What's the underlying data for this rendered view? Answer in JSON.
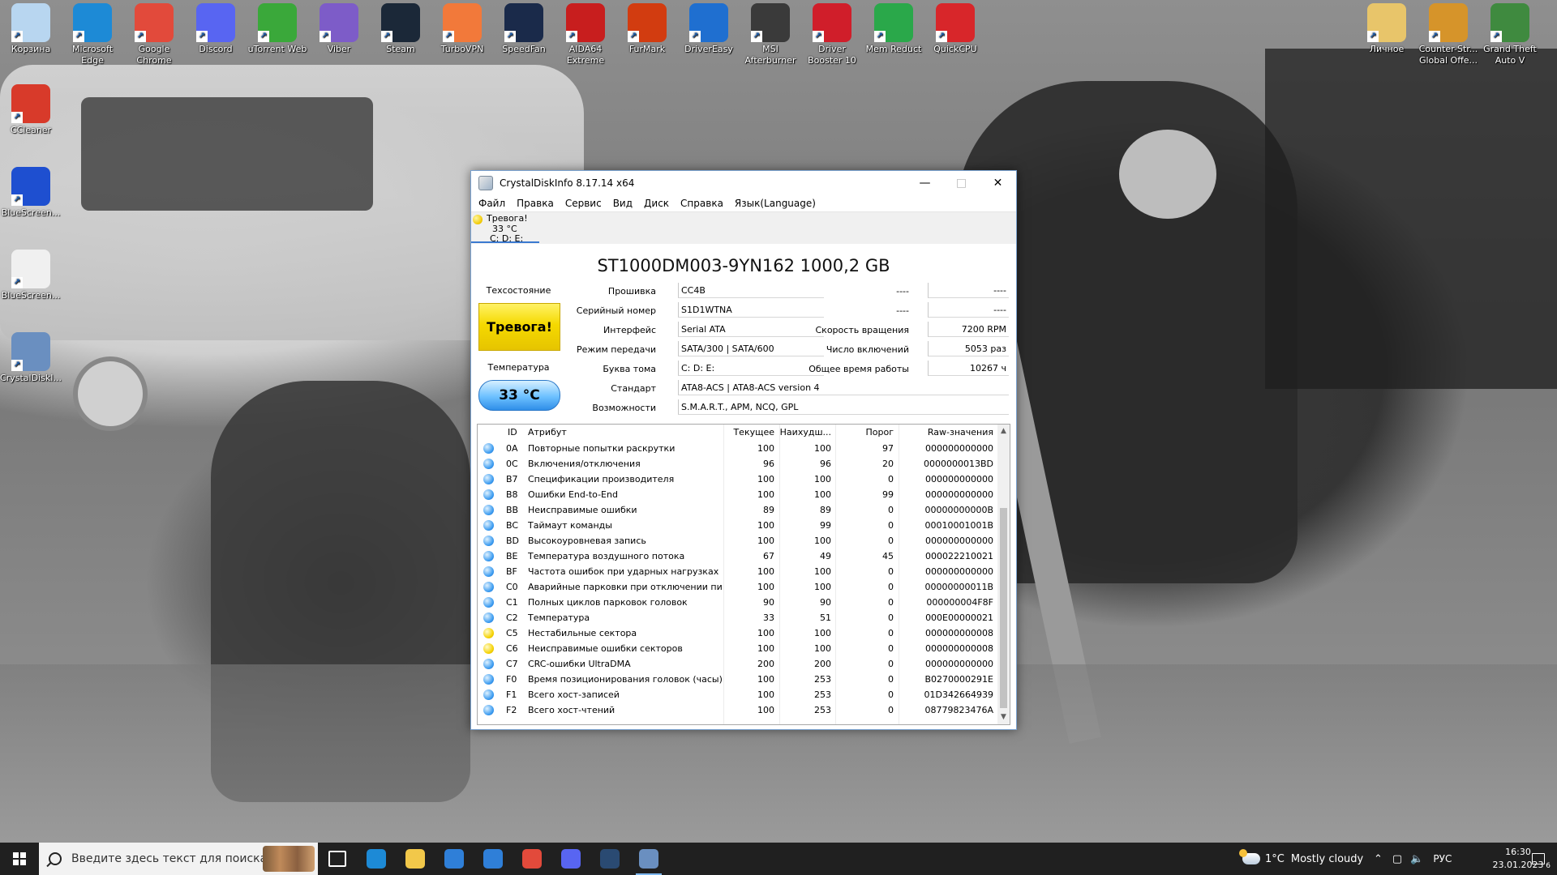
{
  "desktop": {
    "top_icons": [
      {
        "label": "Корзина",
        "icon": "recycle-bin-icon",
        "color": "#b8d6f0"
      },
      {
        "label": "Microsoft Edge",
        "icon": "edge-icon",
        "color": "#1d8ad6"
      },
      {
        "label": "Google Chrome",
        "icon": "chrome-icon",
        "color": "#e24a3b"
      },
      {
        "label": "Discord",
        "icon": "discord-icon",
        "color": "#5865f2"
      },
      {
        "label": "uTorrent Web",
        "icon": "utorrent-icon",
        "color": "#3aa83a"
      },
      {
        "label": "Viber",
        "icon": "viber-icon",
        "color": "#7d5cc8"
      },
      {
        "label": "Steam",
        "icon": "steam-icon",
        "color": "#1b2838"
      },
      {
        "label": "TurboVPN",
        "icon": "turbovpn-icon",
        "color": "#f2793a"
      },
      {
        "label": "SpeedFan",
        "icon": "speedfan-icon",
        "color": "#1a2a4a"
      },
      {
        "label": "AIDA64 Extreme",
        "icon": "aida64-icon",
        "color": "#c81e1e"
      },
      {
        "label": "FurMark",
        "icon": "furmark-icon",
        "color": "#d23c10"
      },
      {
        "label": "DriverEasy",
        "icon": "drivereasy-icon",
        "color": "#1f6fd0"
      },
      {
        "label": "MSI Afterburner",
        "icon": "msi-afterburner-icon",
        "color": "#3a3a3a"
      },
      {
        "label": "Driver Booster 10",
        "icon": "driver-booster-icon",
        "color": "#d01e2a"
      },
      {
        "label": "Mem Reduct",
        "icon": "mem-reduct-icon",
        "color": "#2aa84a"
      },
      {
        "label": "QuickCPU",
        "icon": "quickcpu-icon",
        "color": "#d8262a"
      }
    ],
    "right_icons": [
      {
        "label": "Личное",
        "icon": "folder-icon",
        "color": "#e8c56a"
      },
      {
        "label": "Counter-Str... Global Offe...",
        "icon": "csgo-icon",
        "color": "#d6942a"
      },
      {
        "label": "Grand Theft Auto V",
        "icon": "gta-icon",
        "color": "#3f8a3f"
      }
    ],
    "left_icons": [
      {
        "label": "CCleaner",
        "icon": "ccleaner-icon",
        "color": "#d83a2a"
      },
      {
        "label": "BlueScreen...",
        "icon": "bluescreen-icon",
        "color": "#1e4fd0"
      },
      {
        "label": "BlueScreen...",
        "icon": "document-icon",
        "color": "#f0f0f0"
      },
      {
        "label": "CrystalDiskI...",
        "icon": "crystaldiskinfo-icon",
        "color": "#6a8fc0"
      }
    ]
  },
  "window": {
    "title": "CrystalDiskInfo 8.17.14 x64",
    "menu": [
      "Файл",
      "Правка",
      "Сервис",
      "Вид",
      "Диск",
      "Справка",
      "Язык(Language)"
    ],
    "disk_tab": {
      "status": "Тревога!",
      "temp": "33 °C",
      "letters": "C: D: E:"
    },
    "model": "ST1000DM003-9YN162 1000,2 GB",
    "health_label": "Техсостояние",
    "health_value": "Тревога!",
    "temp_label": "Температура",
    "temp_value": "33 °C",
    "fields": {
      "firmware_label": "Прошивка",
      "firmware": "CC4B",
      "serial_label": "Серийный номер",
      "serial": "S1D1WTNA",
      "interface_label": "Интерфейс",
      "interface": "Serial ATA",
      "transfer_label": "Режим передачи",
      "transfer": "SATA/300 | SATA/600",
      "volume_label": "Буква тома",
      "volume": "C: D: E:",
      "standard_label": "Стандарт",
      "standard": "ATA8-ACS | ATA8-ACS version 4",
      "features_label": "Возможности",
      "features": "S.M.A.R.T., APM, NCQ, GPL",
      "r1_label": "----",
      "r1_value": "----",
      "r2_label": "----",
      "r2_value": "----",
      "rpm_label": "Скорость вращения",
      "rpm": "7200 RPM",
      "power_count_label": "Число включений",
      "power_count": "5053 раз",
      "power_hours_label": "Общее время работы",
      "power_hours": "10267 ч"
    },
    "table": {
      "headers": {
        "id": "ID",
        "attr": "Атрибут",
        "cur": "Текущее",
        "worst": "Наихудш...",
        "thr": "Порог",
        "raw": "Raw-значения"
      },
      "rows": [
        {
          "s": "blue",
          "id": "0A",
          "name": "Повторные попытки раскрутки",
          "cur": "100",
          "worst": "100",
          "thr": "97",
          "raw": "000000000000"
        },
        {
          "s": "blue",
          "id": "0C",
          "name": "Включения/отключения",
          "cur": "96",
          "worst": "96",
          "thr": "20",
          "raw": "0000000013BD"
        },
        {
          "s": "blue",
          "id": "B7",
          "name": "Спецификации производителя",
          "cur": "100",
          "worst": "100",
          "thr": "0",
          "raw": "000000000000"
        },
        {
          "s": "blue",
          "id": "B8",
          "name": "Ошибки End-to-End",
          "cur": "100",
          "worst": "100",
          "thr": "99",
          "raw": "000000000000"
        },
        {
          "s": "blue",
          "id": "BB",
          "name": "Неисправимые ошибки",
          "cur": "89",
          "worst": "89",
          "thr": "0",
          "raw": "00000000000B"
        },
        {
          "s": "blue",
          "id": "BC",
          "name": "Таймаут команды",
          "cur": "100",
          "worst": "99",
          "thr": "0",
          "raw": "00010001001B"
        },
        {
          "s": "blue",
          "id": "BD",
          "name": "Высокоуровневая запись",
          "cur": "100",
          "worst": "100",
          "thr": "0",
          "raw": "000000000000"
        },
        {
          "s": "blue",
          "id": "BE",
          "name": "Температура воздушного потока",
          "cur": "67",
          "worst": "49",
          "thr": "45",
          "raw": "000022210021"
        },
        {
          "s": "blue",
          "id": "BF",
          "name": "Частота ошибок при ударных нагрузках",
          "cur": "100",
          "worst": "100",
          "thr": "0",
          "raw": "000000000000"
        },
        {
          "s": "blue",
          "id": "C0",
          "name": "Аварийные парковки при отключении пи...",
          "cur": "100",
          "worst": "100",
          "thr": "0",
          "raw": "00000000011B"
        },
        {
          "s": "blue",
          "id": "C1",
          "name": "Полных циклов парковок головок",
          "cur": "90",
          "worst": "90",
          "thr": "0",
          "raw": "000000004F8F"
        },
        {
          "s": "blue",
          "id": "C2",
          "name": "Температура",
          "cur": "33",
          "worst": "51",
          "thr": "0",
          "raw": "000E00000021"
        },
        {
          "s": "yellow",
          "id": "C5",
          "name": "Нестабильные сектора",
          "cur": "100",
          "worst": "100",
          "thr": "0",
          "raw": "000000000008"
        },
        {
          "s": "yellow",
          "id": "C6",
          "name": "Неисправимые ошибки секторов",
          "cur": "100",
          "worst": "100",
          "thr": "0",
          "raw": "000000000008"
        },
        {
          "s": "blue",
          "id": "C7",
          "name": "CRC-ошибки UltraDMA",
          "cur": "200",
          "worst": "200",
          "thr": "0",
          "raw": "000000000000"
        },
        {
          "s": "blue",
          "id": "F0",
          "name": "Время позиционирования головок (часы)",
          "cur": "100",
          "worst": "253",
          "thr": "0",
          "raw": "B0270000291E"
        },
        {
          "s": "blue",
          "id": "F1",
          "name": "Всего хост-записей",
          "cur": "100",
          "worst": "253",
          "thr": "0",
          "raw": "01D342664939"
        },
        {
          "s": "blue",
          "id": "F2",
          "name": "Всего хост-чтений",
          "cur": "100",
          "worst": "253",
          "thr": "0",
          "raw": "08779823476A"
        }
      ]
    }
  },
  "taskbar": {
    "search_placeholder": "Введите здесь текст для поиска",
    "apps": [
      {
        "icon": "task-view-icon",
        "color": "#ffffff"
      },
      {
        "icon": "edge-icon",
        "color": "#1d8ad6"
      },
      {
        "icon": "file-explorer-icon",
        "color": "#f2c84a"
      },
      {
        "icon": "microsoft-store-icon",
        "color": "#2f7fd8"
      },
      {
        "icon": "mail-icon",
        "color": "#2f7fd8"
      },
      {
        "icon": "chrome-icon",
        "color": "#e24a3b"
      },
      {
        "icon": "discord-icon",
        "color": "#5865f2"
      },
      {
        "icon": "steam-icon",
        "color": "#2a4a72"
      },
      {
        "icon": "crystaldiskinfo-icon",
        "color": "#6a8fc0"
      }
    ],
    "weather_temp": "1°C",
    "weather_text": "Mostly cloudy",
    "lang": "РУС",
    "time": "16:30",
    "date": "23.01.2023",
    "notification_count": "6"
  }
}
